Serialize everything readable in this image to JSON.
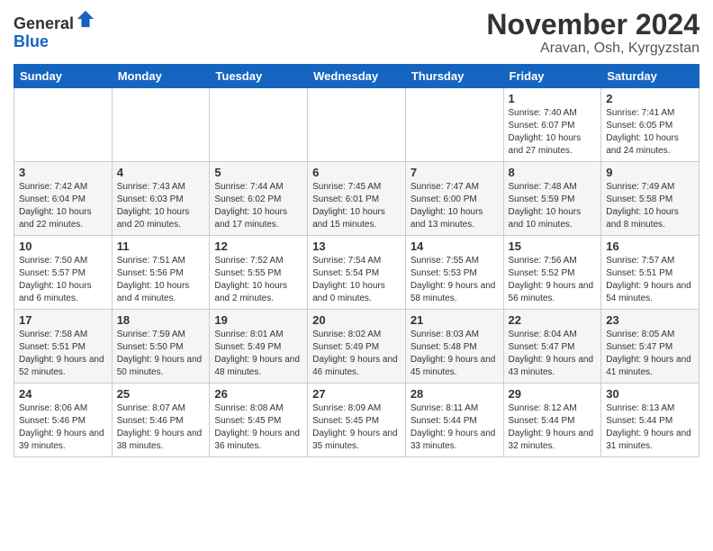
{
  "header": {
    "logo_general": "General",
    "logo_blue": "Blue",
    "month_title": "November 2024",
    "location": "Aravan, Osh, Kyrgyzstan"
  },
  "weekdays": [
    "Sunday",
    "Monday",
    "Tuesday",
    "Wednesday",
    "Thursday",
    "Friday",
    "Saturday"
  ],
  "weeks": [
    [
      {
        "day": "",
        "info": ""
      },
      {
        "day": "",
        "info": ""
      },
      {
        "day": "",
        "info": ""
      },
      {
        "day": "",
        "info": ""
      },
      {
        "day": "",
        "info": ""
      },
      {
        "day": "1",
        "info": "Sunrise: 7:40 AM\nSunset: 6:07 PM\nDaylight: 10 hours and 27 minutes."
      },
      {
        "day": "2",
        "info": "Sunrise: 7:41 AM\nSunset: 6:05 PM\nDaylight: 10 hours and 24 minutes."
      }
    ],
    [
      {
        "day": "3",
        "info": "Sunrise: 7:42 AM\nSunset: 6:04 PM\nDaylight: 10 hours and 22 minutes."
      },
      {
        "day": "4",
        "info": "Sunrise: 7:43 AM\nSunset: 6:03 PM\nDaylight: 10 hours and 20 minutes."
      },
      {
        "day": "5",
        "info": "Sunrise: 7:44 AM\nSunset: 6:02 PM\nDaylight: 10 hours and 17 minutes."
      },
      {
        "day": "6",
        "info": "Sunrise: 7:45 AM\nSunset: 6:01 PM\nDaylight: 10 hours and 15 minutes."
      },
      {
        "day": "7",
        "info": "Sunrise: 7:47 AM\nSunset: 6:00 PM\nDaylight: 10 hours and 13 minutes."
      },
      {
        "day": "8",
        "info": "Sunrise: 7:48 AM\nSunset: 5:59 PM\nDaylight: 10 hours and 10 minutes."
      },
      {
        "day": "9",
        "info": "Sunrise: 7:49 AM\nSunset: 5:58 PM\nDaylight: 10 hours and 8 minutes."
      }
    ],
    [
      {
        "day": "10",
        "info": "Sunrise: 7:50 AM\nSunset: 5:57 PM\nDaylight: 10 hours and 6 minutes."
      },
      {
        "day": "11",
        "info": "Sunrise: 7:51 AM\nSunset: 5:56 PM\nDaylight: 10 hours and 4 minutes."
      },
      {
        "day": "12",
        "info": "Sunrise: 7:52 AM\nSunset: 5:55 PM\nDaylight: 10 hours and 2 minutes."
      },
      {
        "day": "13",
        "info": "Sunrise: 7:54 AM\nSunset: 5:54 PM\nDaylight: 10 hours and 0 minutes."
      },
      {
        "day": "14",
        "info": "Sunrise: 7:55 AM\nSunset: 5:53 PM\nDaylight: 9 hours and 58 minutes."
      },
      {
        "day": "15",
        "info": "Sunrise: 7:56 AM\nSunset: 5:52 PM\nDaylight: 9 hours and 56 minutes."
      },
      {
        "day": "16",
        "info": "Sunrise: 7:57 AM\nSunset: 5:51 PM\nDaylight: 9 hours and 54 minutes."
      }
    ],
    [
      {
        "day": "17",
        "info": "Sunrise: 7:58 AM\nSunset: 5:51 PM\nDaylight: 9 hours and 52 minutes."
      },
      {
        "day": "18",
        "info": "Sunrise: 7:59 AM\nSunset: 5:50 PM\nDaylight: 9 hours and 50 minutes."
      },
      {
        "day": "19",
        "info": "Sunrise: 8:01 AM\nSunset: 5:49 PM\nDaylight: 9 hours and 48 minutes."
      },
      {
        "day": "20",
        "info": "Sunrise: 8:02 AM\nSunset: 5:49 PM\nDaylight: 9 hours and 46 minutes."
      },
      {
        "day": "21",
        "info": "Sunrise: 8:03 AM\nSunset: 5:48 PM\nDaylight: 9 hours and 45 minutes."
      },
      {
        "day": "22",
        "info": "Sunrise: 8:04 AM\nSunset: 5:47 PM\nDaylight: 9 hours and 43 minutes."
      },
      {
        "day": "23",
        "info": "Sunrise: 8:05 AM\nSunset: 5:47 PM\nDaylight: 9 hours and 41 minutes."
      }
    ],
    [
      {
        "day": "24",
        "info": "Sunrise: 8:06 AM\nSunset: 5:46 PM\nDaylight: 9 hours and 39 minutes."
      },
      {
        "day": "25",
        "info": "Sunrise: 8:07 AM\nSunset: 5:46 PM\nDaylight: 9 hours and 38 minutes."
      },
      {
        "day": "26",
        "info": "Sunrise: 8:08 AM\nSunset: 5:45 PM\nDaylight: 9 hours and 36 minutes."
      },
      {
        "day": "27",
        "info": "Sunrise: 8:09 AM\nSunset: 5:45 PM\nDaylight: 9 hours and 35 minutes."
      },
      {
        "day": "28",
        "info": "Sunrise: 8:11 AM\nSunset: 5:44 PM\nDaylight: 9 hours and 33 minutes."
      },
      {
        "day": "29",
        "info": "Sunrise: 8:12 AM\nSunset: 5:44 PM\nDaylight: 9 hours and 32 minutes."
      },
      {
        "day": "30",
        "info": "Sunrise: 8:13 AM\nSunset: 5:44 PM\nDaylight: 9 hours and 31 minutes."
      }
    ]
  ]
}
